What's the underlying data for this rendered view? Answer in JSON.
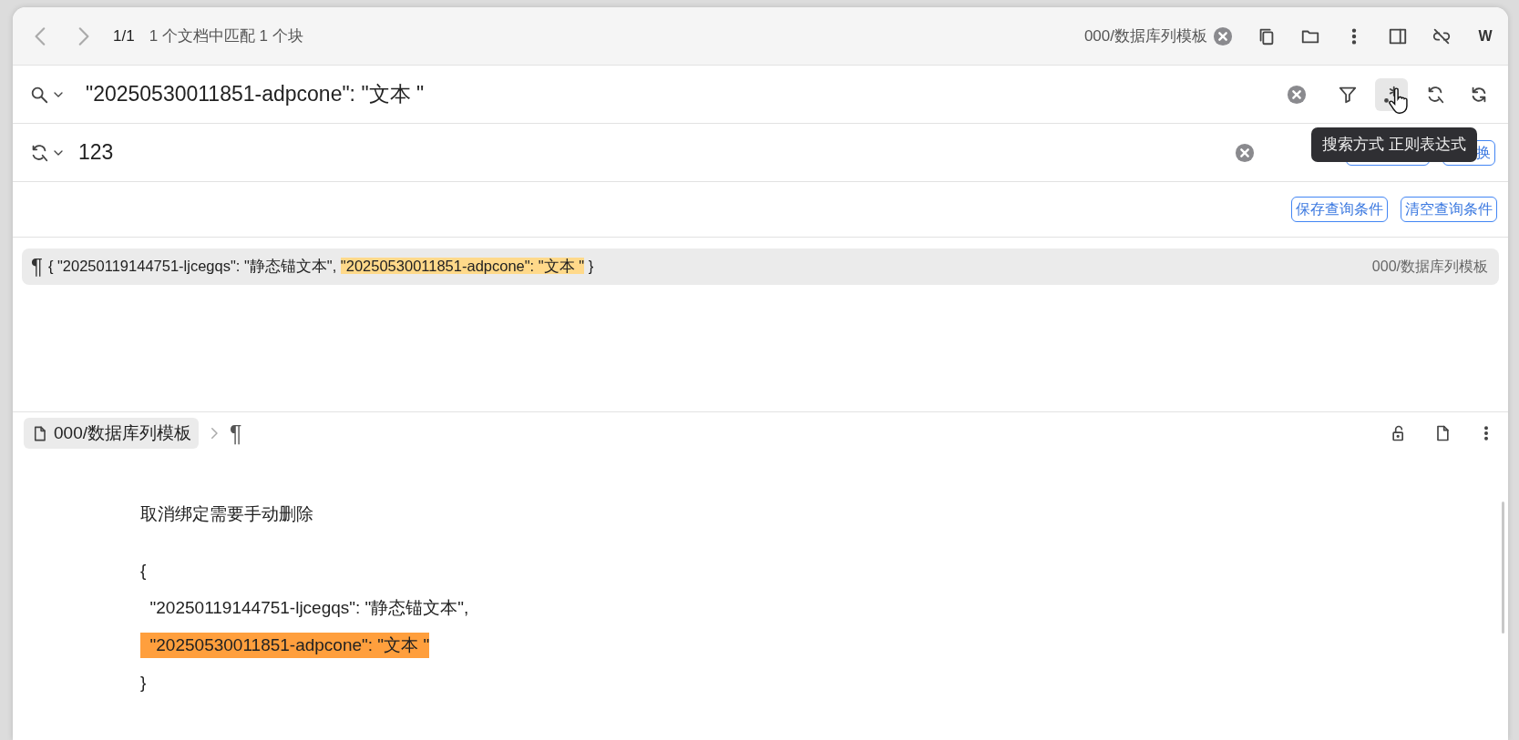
{
  "toolbar": {
    "position": "1/1",
    "summary": "1 个文档中匹配 1 个块",
    "path_filter": "000/数据库列模板",
    "avatar": "W"
  },
  "search": {
    "value": "\"20250530011851-adpcone\": \"文本 \"",
    "tools": [
      {
        "kind": "clear",
        "hovered": false
      },
      {
        "kind": "filter",
        "hovered": false
      },
      {
        "kind": "regex",
        "hovered": true
      },
      {
        "kind": "replace-mode",
        "hovered": false
      },
      {
        "kind": "refresh",
        "hovered": false
      }
    ]
  },
  "tooltip": "搜索方式 正则表达式",
  "replace": {
    "value": "123",
    "buttons": [
      {
        "kind": "replace-all"
      },
      {
        "kind": "replace",
        "label": "换"
      }
    ]
  },
  "query_buttons": [
    "保存查询条件",
    "清空查询条件"
  ],
  "results": [
    {
      "marker": "¶",
      "before": "{ \"20250119144751-ljcegqs\": \"静态锚文本\", ",
      "match": "\"20250530011851-adpcone\": \"文本 \"",
      "after": " }",
      "path": "000/数据库列模板",
      "selected": true
    }
  ],
  "preview": {
    "breadcrumb": "000/数据库列模板",
    "marker": "¶",
    "lines": [
      {
        "text": "取消绑定需要手动删除",
        "highlighted": false,
        "gap": true
      },
      {
        "text": "{",
        "highlighted": false,
        "gap": false
      },
      {
        "text": "  \"20250119144751-ljcegqs\": \"静态锚文本\",",
        "highlighted": false,
        "gap": false
      },
      {
        "text": "  \"20250530011851-adpcone\": \"文本 \"",
        "highlighted": true,
        "gap": false
      },
      {
        "text": "}",
        "highlighted": false,
        "gap": false
      }
    ]
  }
}
